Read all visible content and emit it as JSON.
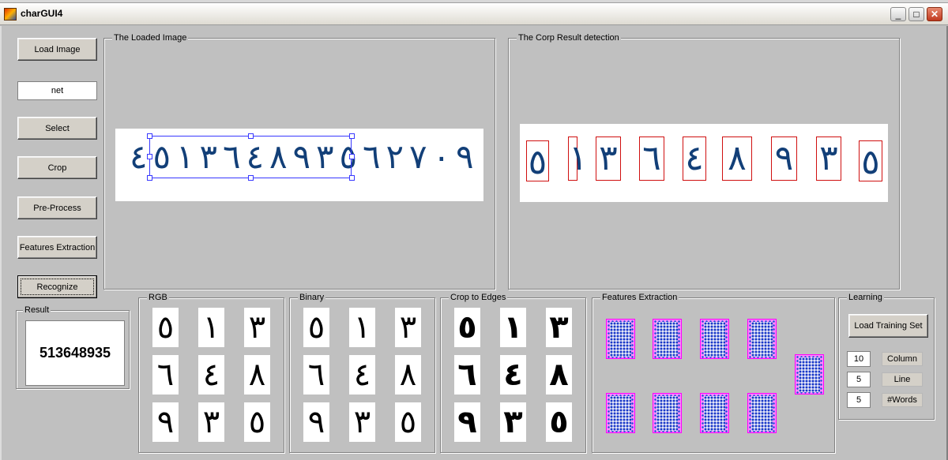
{
  "window": {
    "title": "charGUI4",
    "minimize": "_",
    "maximize": "□",
    "close": "✕"
  },
  "buttons": {
    "load_image": "Load Image",
    "select": "Select",
    "crop": "Crop",
    "preprocess": "Pre-Process",
    "features": "Features Extraction",
    "recognize": "Recognize"
  },
  "net_field": {
    "value": "net"
  },
  "panels": {
    "loaded_image": "The Loaded Image",
    "crop_result": "The Corp Result detection",
    "result": "Result",
    "rgb": "RGB",
    "binary": "Binary",
    "crop_edges": "Crop to Edges",
    "features": "Features Extraction",
    "learning": "Learning"
  },
  "loaded_digits": [
    "٤",
    "٥",
    "١",
    "٣",
    "٦",
    "٤",
    "٨",
    "٩",
    "٣",
    "٥",
    "٦",
    "٢",
    "٧",
    "٠",
    "٩"
  ],
  "crop_digits": [
    "٥",
    "١",
    "٣",
    "٦",
    "٤",
    "٨",
    "٩",
    "٣",
    "٥"
  ],
  "result": {
    "value": "513648935"
  },
  "learning": {
    "load_training_set": "Load Training Set",
    "column_value": "10",
    "column_label": "Column",
    "line_value": "5",
    "line_label": "Line",
    "words_value": "5",
    "words_label": "#Words"
  },
  "colors": {
    "digit_blue": "#123f78",
    "box_red": "#d01010",
    "feature_magenta": "#ff00ff"
  }
}
